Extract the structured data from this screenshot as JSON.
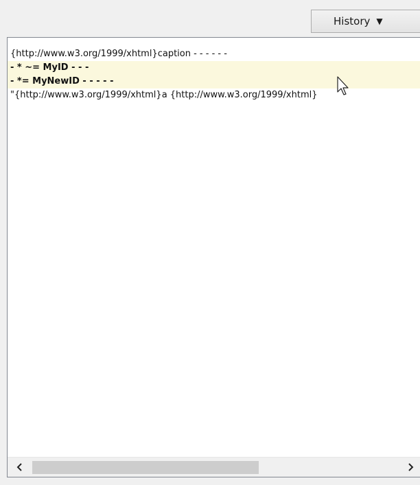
{
  "toolbar": {
    "history_label": "History",
    "history_caret": "▼"
  },
  "panel": {
    "lines": [
      "{http://www.w3.org/1999/xhtml}caption - - - - - -",
      "- * ~= MyID - - -",
      "- *= MyNewID - - - - -",
      "\"{http://www.w3.org/1999/xhtml}a {http://www.w3.org/1999/xhtml}"
    ]
  },
  "scrollbar": {
    "left_arrow": "‹",
    "right_arrow": "›"
  },
  "colors": {
    "highlight": "#fbf8dd",
    "panel_border": "#828790",
    "scroll_thumb": "#cdcdcd"
  }
}
